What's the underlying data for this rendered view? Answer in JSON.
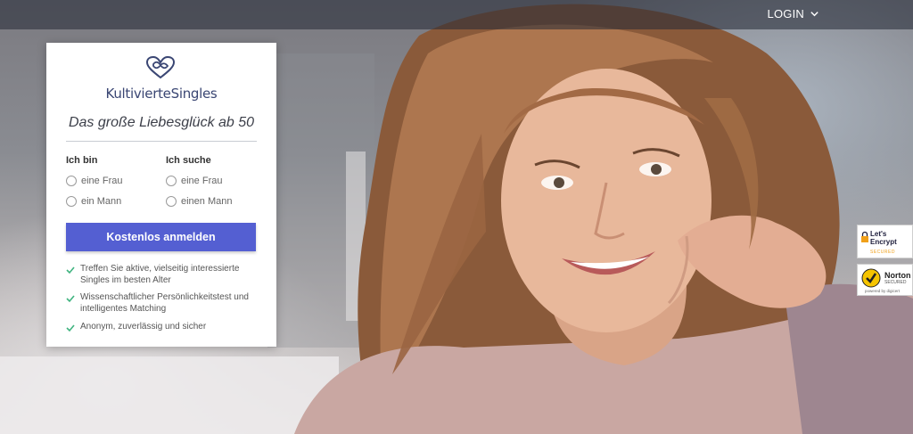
{
  "header": {
    "login_label": "LOGIN"
  },
  "signup": {
    "brand": "KultivierteSingles",
    "tagline": "Das große Liebesglück ab 50",
    "i_am_label": "Ich bin",
    "seeking_label": "Ich suche",
    "i_am_options": [
      "eine Frau",
      "ein Mann"
    ],
    "seeking_options": [
      "eine Frau",
      "einen Mann"
    ],
    "cta_label": "Kostenlos anmelden",
    "features": [
      "Treffen Sie aktive, vielseitig interessierte Singles im besten Alter",
      "Wissenschaftlicher Persönlichkeitstest und intelligentes Matching",
      "Anonym, zuverlässig und sicher"
    ]
  },
  "badges": {
    "letsencrypt_line1": "Let's",
    "letsencrypt_line2": "Encrypt",
    "letsencrypt_sub": "SECURED",
    "norton_title": "Norton",
    "norton_sub": "SECURED",
    "norton_powered": "powered by digicert"
  },
  "colors": {
    "brand": "#3a4673",
    "cta": "#545fd2",
    "check": "#3fb37f"
  },
  "icons": {
    "logo": "heart-infinity-icon",
    "login_chevron": "chevron-down-icon",
    "feature_bullet": "checkmark-icon"
  }
}
